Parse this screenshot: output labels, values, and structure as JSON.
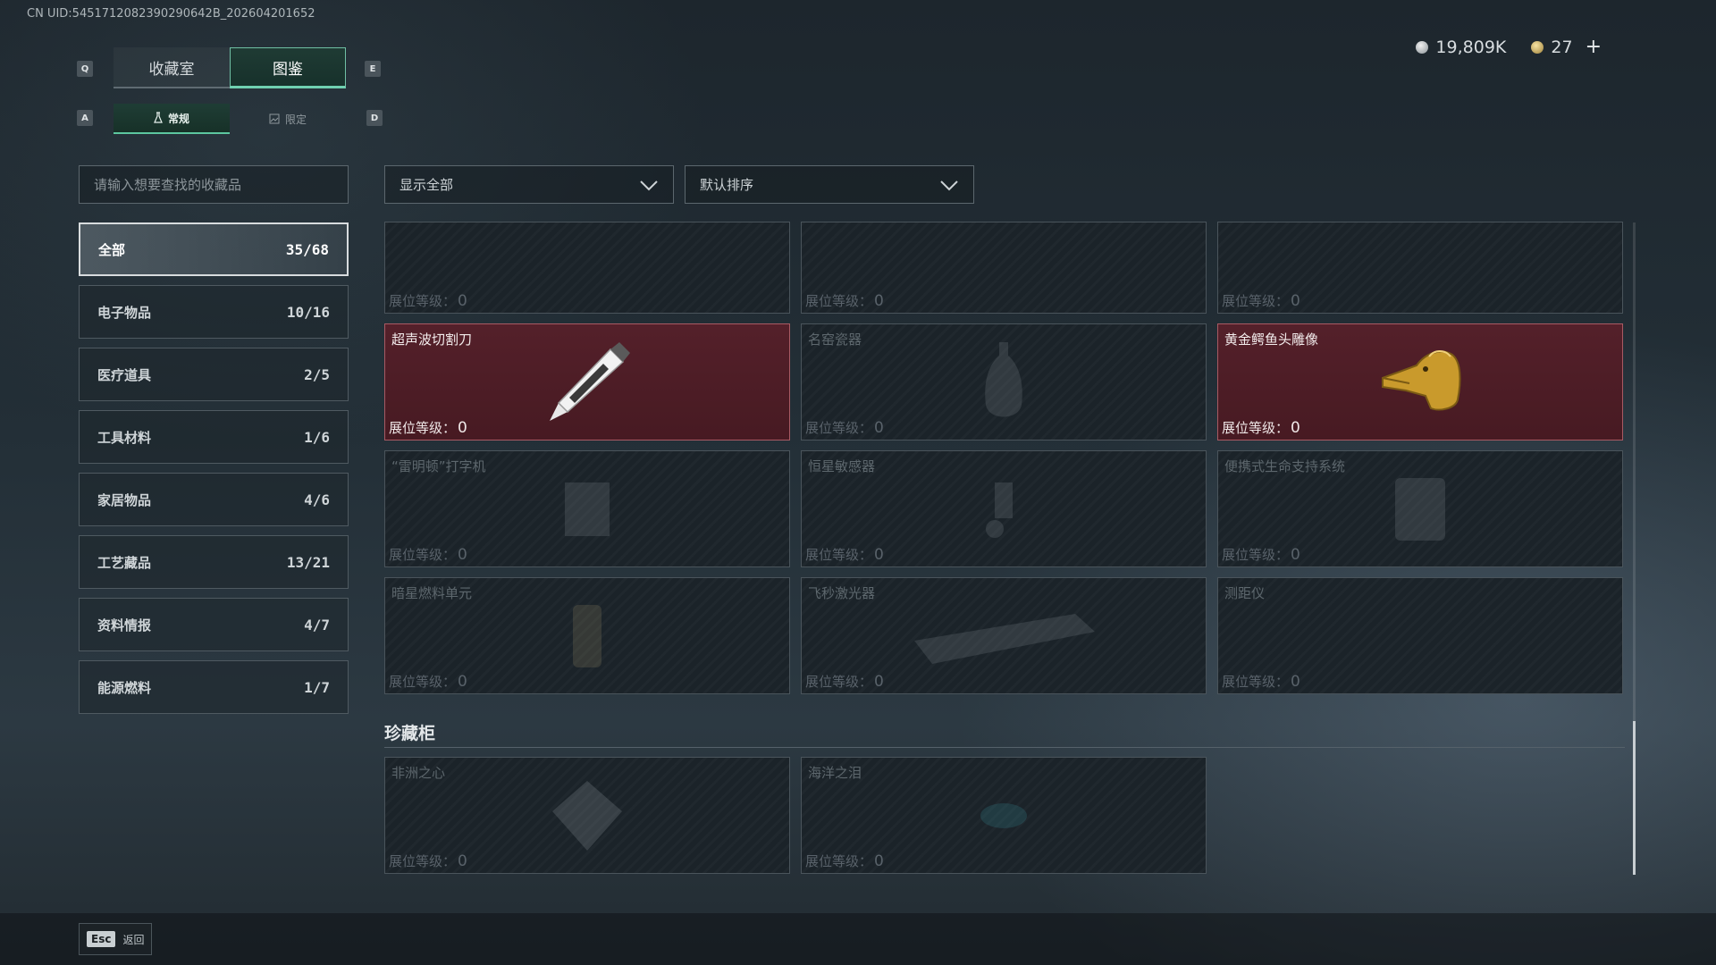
{
  "uid": "CN UID:5451712082390290642B_202604201652",
  "currency": {
    "silver": "19,809K",
    "gold": "27",
    "plus": "+"
  },
  "keys": {
    "q": "Q",
    "e": "E",
    "a": "A",
    "d": "D"
  },
  "tabs": [
    {
      "label": "收藏室",
      "active": false
    },
    {
      "label": "图鉴",
      "active": true
    }
  ],
  "subtabs": [
    {
      "label": "常规",
      "active": true
    },
    {
      "label": "限定",
      "active": false
    }
  ],
  "search": {
    "placeholder": "请输入想要查找的收藏品",
    "value": ""
  },
  "categories": [
    {
      "label": "全部",
      "count": "35/68"
    },
    {
      "label": "电子物品",
      "count": "10/16"
    },
    {
      "label": "医疗道具",
      "count": "2/5"
    },
    {
      "label": "工具材料",
      "count": "1/6"
    },
    {
      "label": "家居物品",
      "count": "4/6"
    },
    {
      "label": "工艺藏品",
      "count": "13/21"
    },
    {
      "label": "资料情报",
      "count": "4/7"
    },
    {
      "label": "能源燃料",
      "count": "1/7"
    }
  ],
  "filters": {
    "show": "显示全部",
    "sort": "默认排序"
  },
  "level_label": "展位等级：",
  "items": [
    {
      "name": "",
      "level": "0",
      "owned": false
    },
    {
      "name": "",
      "level": "0",
      "owned": false
    },
    {
      "name": "",
      "level": "0",
      "owned": false
    },
    {
      "name": "超声波切割刀",
      "level": "0",
      "owned": true
    },
    {
      "name": "名窑瓷器",
      "level": "0",
      "owned": false
    },
    {
      "name": "黄金鳄鱼头雕像",
      "level": "0",
      "owned": true
    },
    {
      "name": "“雷明顿”打字机",
      "level": "0",
      "owned": false
    },
    {
      "name": "恒星敏感器",
      "level": "0",
      "owned": false
    },
    {
      "name": "便携式生命支持系统",
      "level": "0",
      "owned": false
    },
    {
      "name": "暗星燃料单元",
      "level": "0",
      "owned": false
    },
    {
      "name": "飞秒激光器",
      "level": "0",
      "owned": false
    },
    {
      "name": "测距仪",
      "level": "0",
      "owned": false
    }
  ],
  "section": {
    "title": "珍藏柜"
  },
  "treasures": [
    {
      "name": "非洲之心",
      "level": "0",
      "owned": false
    },
    {
      "name": "海洋之泪",
      "level": "0",
      "owned": false
    }
  ],
  "esc": {
    "key": "Esc",
    "label": "返回"
  },
  "colors": {
    "accent": "#6fd0b0",
    "owned_bg": "#4d1d25",
    "panel_border": "#4a545b"
  }
}
